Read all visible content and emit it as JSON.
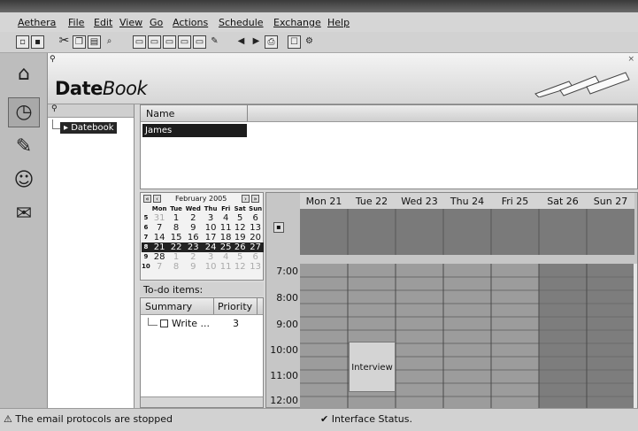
{
  "menubar": {
    "items": [
      "Aethera",
      "File",
      "Edit",
      "View",
      "Go",
      "Actions",
      "Schedule",
      "Exchange",
      "Help"
    ]
  },
  "toolbar": {
    "icons": [
      "new-doc-icon",
      "save-icon",
      "cut-icon",
      "copy-icon",
      "paste-icon",
      "find-icon",
      "view1-icon",
      "view2-icon",
      "view3-icon",
      "view4-icon",
      "view5-icon",
      "edit-icon",
      "back-icon",
      "forward-icon",
      "print-icon",
      "tasks-icon",
      "settings-icon"
    ]
  },
  "rail": {
    "icons": [
      "home-icon",
      "datebook-icon",
      "notes-icon",
      "contacts-icon",
      "mail-icon"
    ]
  },
  "component": {
    "title_part1": "Date",
    "title_part2": "Book"
  },
  "tree": {
    "item": "Datebook"
  },
  "list": {
    "column_header": "Name",
    "rows": [
      "James"
    ]
  },
  "minical": {
    "month_label": "February 2005",
    "weekday_heads": [
      "Mon",
      "Tue",
      "Wed",
      "Thu",
      "Fri",
      "Sat",
      "Sun"
    ],
    "weeks": [
      {
        "wk": "5",
        "days": [
          "31",
          "1",
          "2",
          "3",
          "4",
          "5",
          "6"
        ]
      },
      {
        "wk": "6",
        "days": [
          "7",
          "8",
          "9",
          "10",
          "11",
          "12",
          "13"
        ]
      },
      {
        "wk": "7",
        "days": [
          "14",
          "15",
          "16",
          "17",
          "18",
          "19",
          "20"
        ]
      },
      {
        "wk": "8",
        "days": [
          "21",
          "22",
          "23",
          "24",
          "25",
          "26",
          "27"
        ]
      },
      {
        "wk": "9",
        "days": [
          "28",
          "1",
          "2",
          "3",
          "4",
          "5",
          "6"
        ]
      },
      {
        "wk": "10",
        "days": [
          "7",
          "8",
          "9",
          "10",
          "11",
          "12",
          "13"
        ]
      }
    ]
  },
  "todo": {
    "title": "To-do items:",
    "col_summary": "Summary",
    "col_priority": "Priority",
    "rows": [
      {
        "summary": "Write ...",
        "priority": "3"
      }
    ]
  },
  "week": {
    "days": [
      "Mon 21",
      "Tue 22",
      "Wed 23",
      "Thu 24",
      "Fri 25",
      "Sat 26",
      "Sun 27"
    ],
    "hours": [
      "7:00",
      "8:00",
      "9:00",
      "10:00",
      "11:00",
      "12:00"
    ],
    "appointment": "Interview"
  },
  "status": {
    "left": "The email protocols are stopped",
    "right": "Interface Status."
  }
}
